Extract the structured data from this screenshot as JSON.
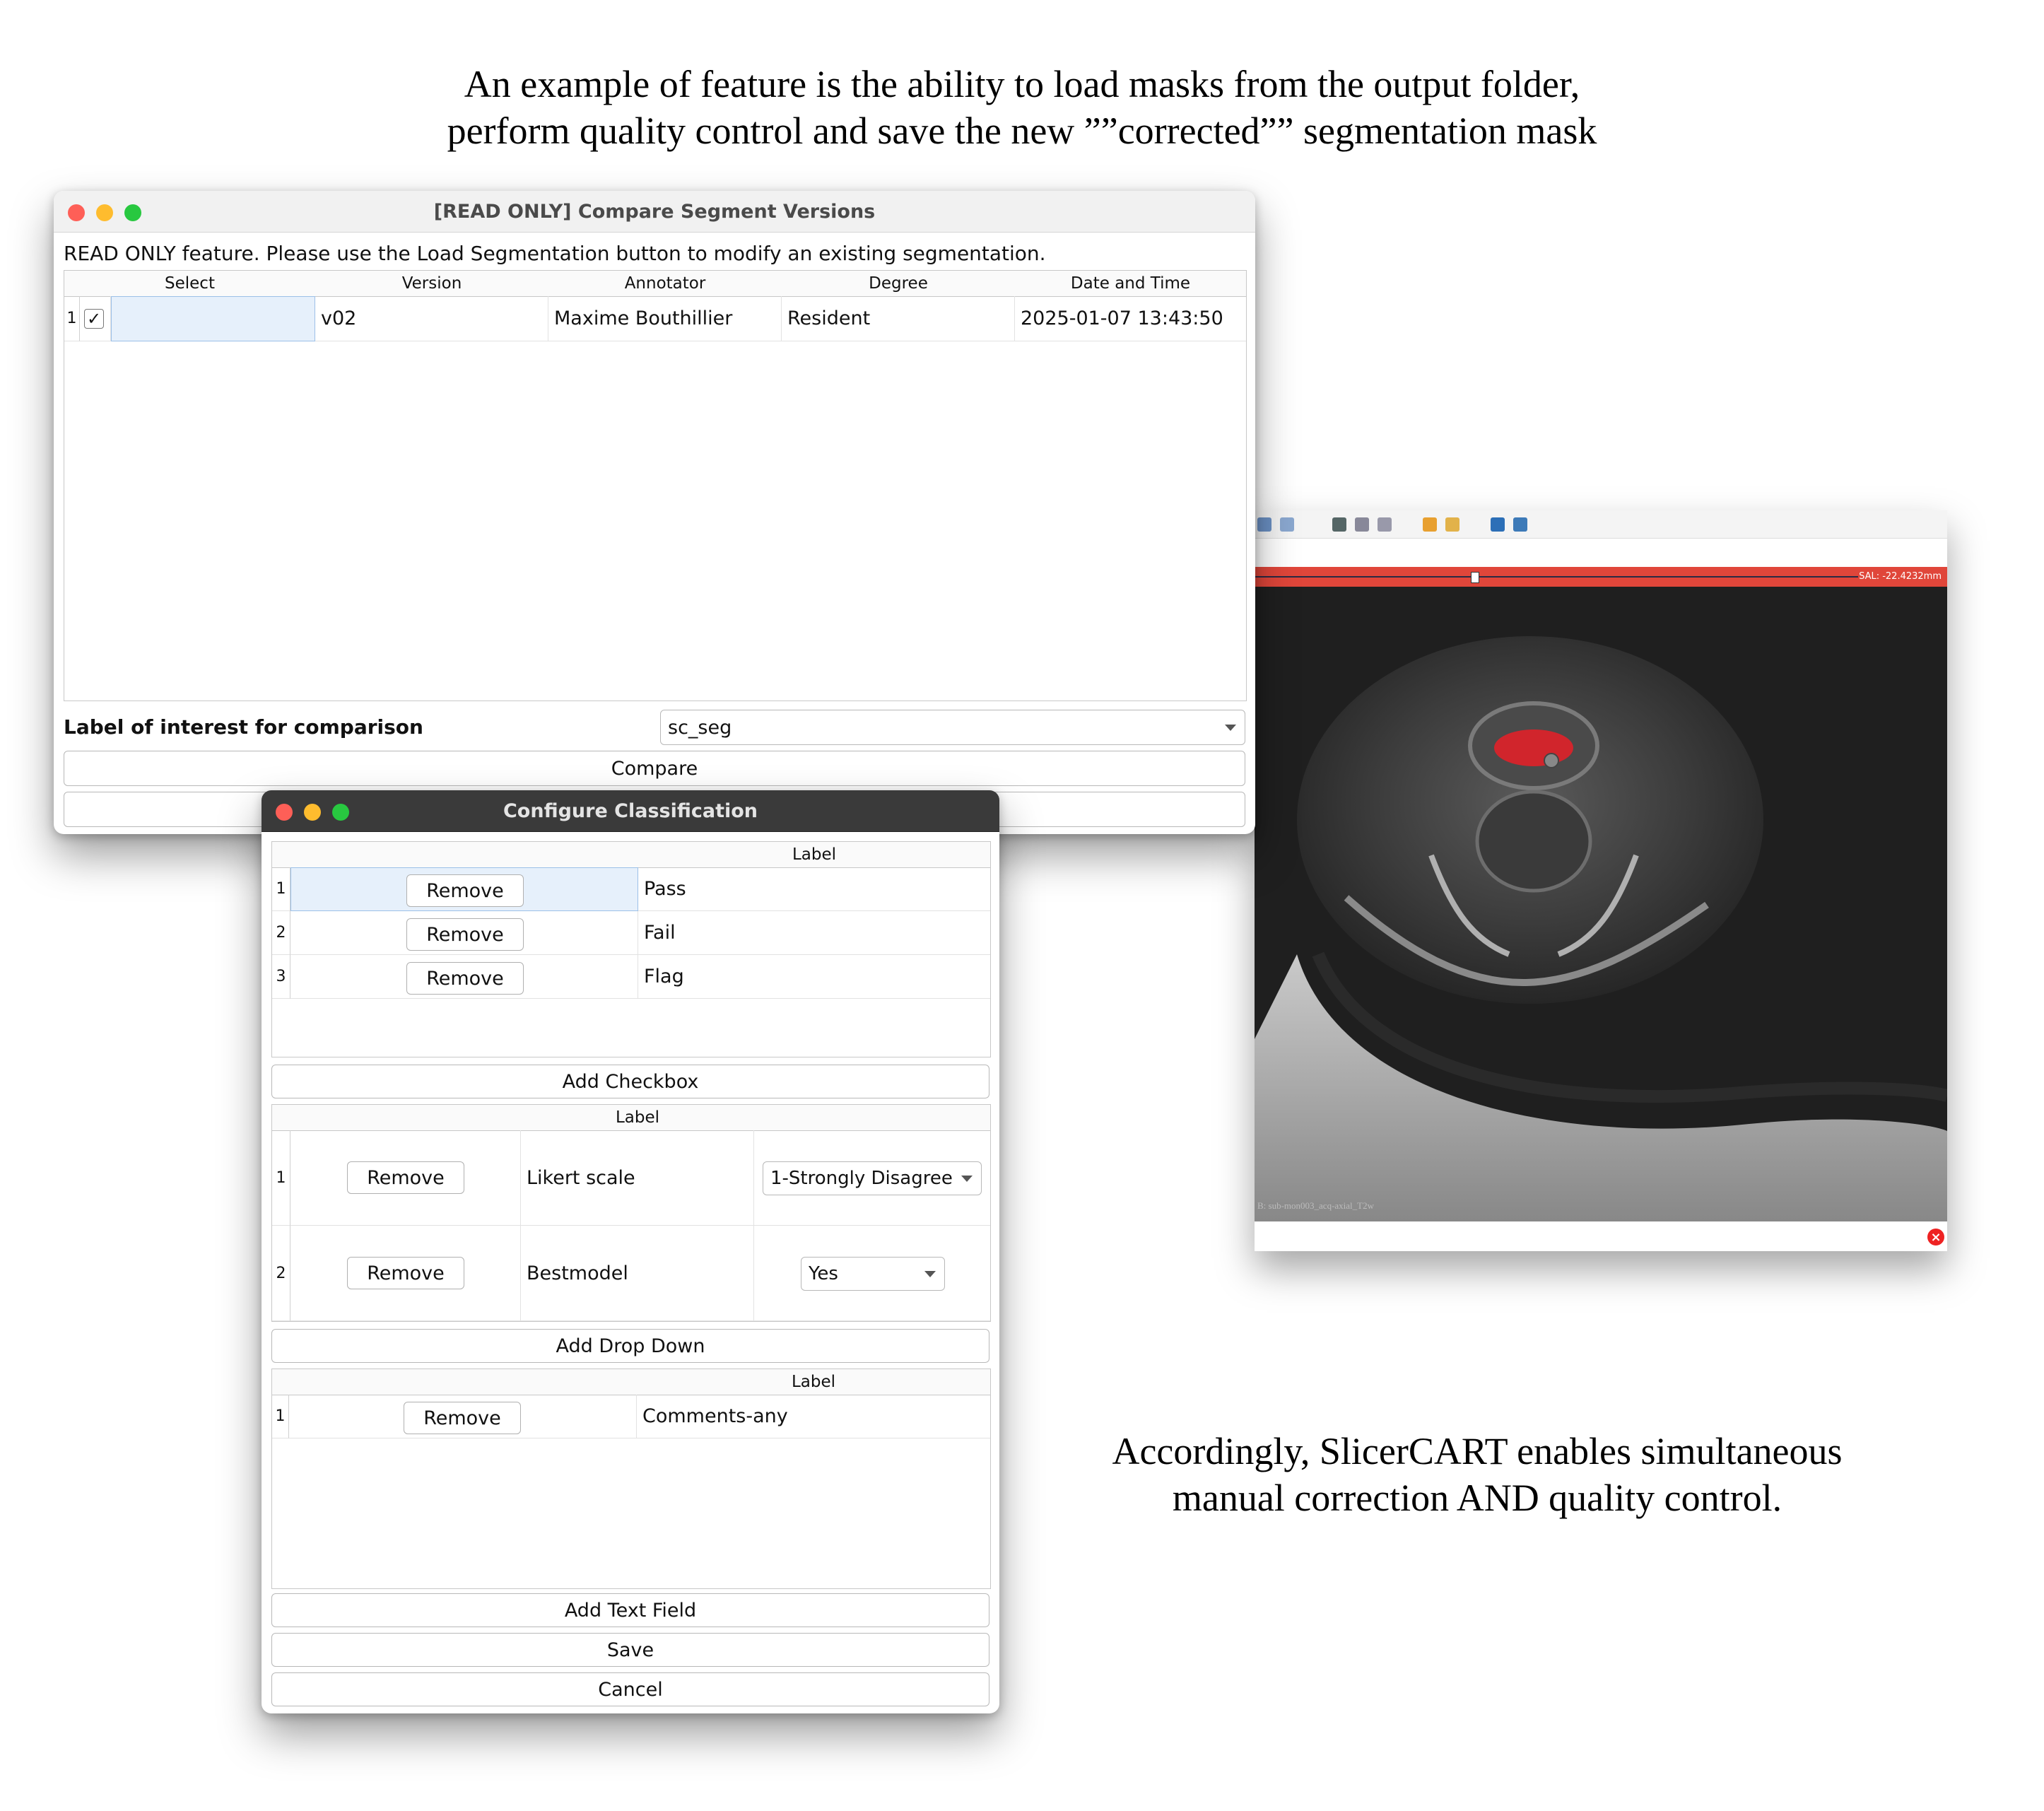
{
  "captions": {
    "top_line1": "An example of feature is the ability to load masks from the output folder,",
    "top_line2": "perform quality control and save the new ””corrected”” segmentation mask",
    "bottom_line1": "Accordingly, SlicerCART enables simultaneous",
    "bottom_line2": "manual correction AND quality control."
  },
  "compare_window": {
    "title": "[READ ONLY] Compare Segment Versions",
    "note": "READ ONLY feature. Please use the Load Segmentation button to modify an existing segmentation.",
    "columns": [
      "Select",
      "Version",
      "Annotator",
      "Degree",
      "Date and Time"
    ],
    "rows": [
      {
        "num": "1",
        "check": "✓",
        "version": "v02",
        "annotator": "Maxime Bouthillier",
        "degree": "Resident",
        "datetime": "2025-01-07 13:43:50"
      }
    ],
    "label_prompt": "Label of interest for comparison",
    "label_value": "sc_seg",
    "compare_button": "Compare"
  },
  "class_window": {
    "title": "Configure Classification",
    "checkbox_section": {
      "header": "Label",
      "rows": [
        {
          "num": "1",
          "remove": "Remove",
          "label": "Pass"
        },
        {
          "num": "2",
          "remove": "Remove",
          "label": "Fail"
        },
        {
          "num": "3",
          "remove": "Remove",
          "label": "Flag"
        }
      ],
      "add_button": "Add Checkbox"
    },
    "dropdown_section": {
      "header": "Label",
      "rows": [
        {
          "num": "1",
          "remove": "Remove",
          "label": "Likert scale",
          "value": "1-Strongly Disagree"
        },
        {
          "num": "2",
          "remove": "Remove",
          "label": "Bestmodel",
          "value": "Yes"
        }
      ],
      "add_button": "Add Drop Down"
    },
    "text_section": {
      "header": "Label",
      "rows": [
        {
          "num": "1",
          "remove": "Remove",
          "label": "Comments-any"
        }
      ],
      "add_button": "Add Text Field"
    },
    "save_button": "Save",
    "cancel_button": "Cancel"
  },
  "slicer": {
    "slice_offset": "SAL: -22.4232mm",
    "series": "B: sub-mon003_acq-axial_T2w",
    "close_glyph": "×"
  }
}
